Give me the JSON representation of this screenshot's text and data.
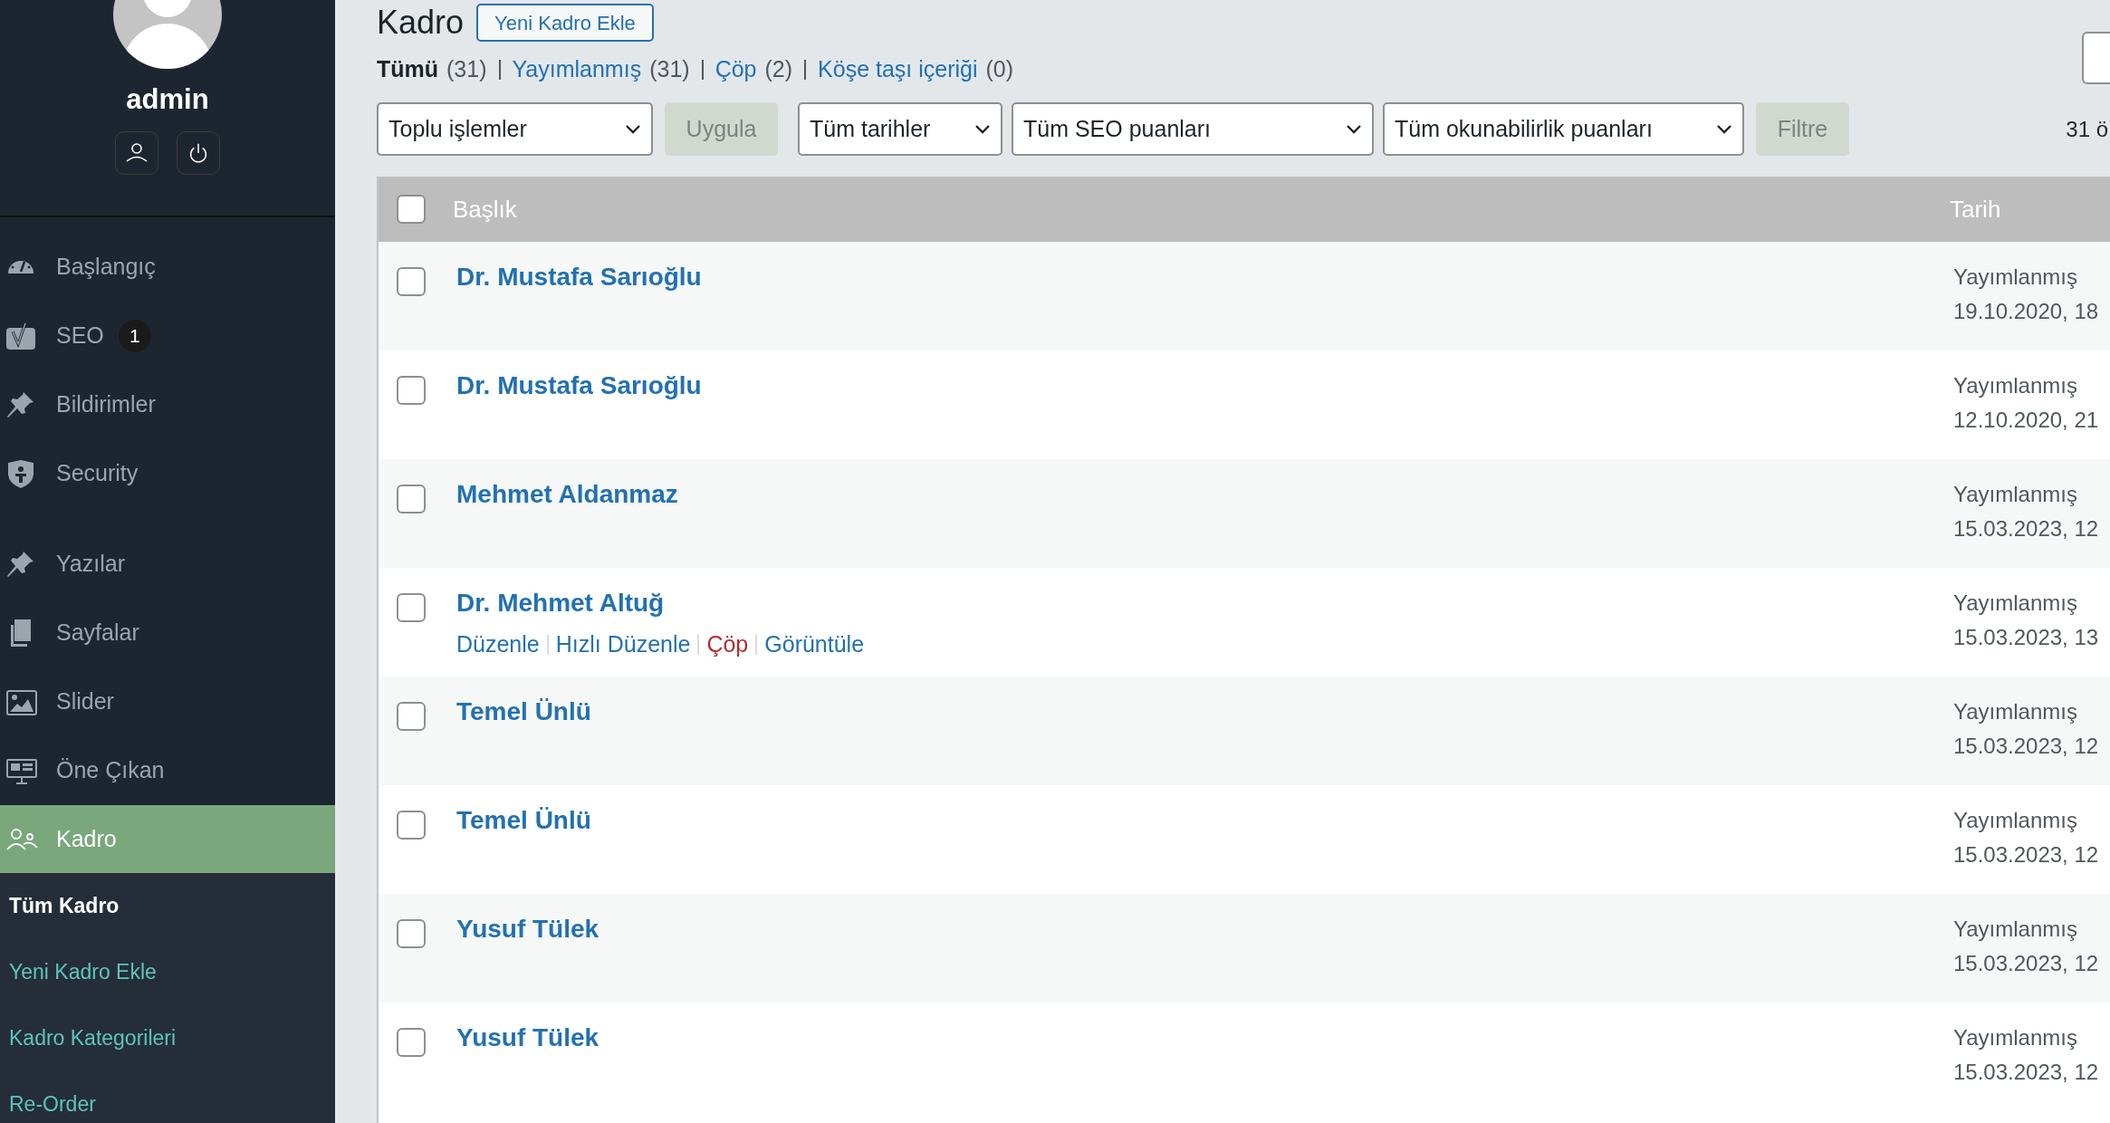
{
  "sidebar": {
    "user": {
      "name": "admin"
    },
    "menu_groups": [
      [
        {
          "label": "Başlangıç",
          "selected": false
        },
        {
          "label": "SEO",
          "badge": "1",
          "selected": false
        },
        {
          "label": "Bildirimler",
          "selected": false
        },
        {
          "label": "Security",
          "selected": false
        }
      ],
      [
        {
          "label": "Yazılar",
          "selected": false
        },
        {
          "label": "Sayfalar",
          "selected": false
        },
        {
          "label": "Slider",
          "selected": false
        },
        {
          "label": "Öne Çıkan",
          "selected": false
        },
        {
          "label": "Kadro",
          "selected": true
        }
      ]
    ],
    "submenu": [
      {
        "label": "Tüm Kadro",
        "selected": true
      },
      {
        "label": "Yeni Kadro Ekle",
        "selected": false
      },
      {
        "label": "Kadro Kategorileri",
        "selected": false
      },
      {
        "label": "Re-Order",
        "selected": false
      }
    ]
  },
  "page": {
    "title": "Kadro",
    "add_button": "Yeni Kadro Ekle"
  },
  "views": [
    {
      "label": "Tümü",
      "count": "(31)",
      "selected": true
    },
    {
      "label": "Yayımlanmış",
      "count": "(31)",
      "selected": false
    },
    {
      "label": "Çöp",
      "count": "(2)",
      "selected": false
    },
    {
      "label": "Köşe taşı içeriği",
      "count": "(0)",
      "selected": false
    }
  ],
  "filters": [
    {
      "kind": "select",
      "value": "Toplu işlemler"
    },
    {
      "kind": "button",
      "label": "Uygula",
      "disabled": true
    },
    {
      "kind": "select",
      "value": "Tüm tarihler"
    },
    {
      "kind": "select",
      "value": "Tüm SEO puanları"
    },
    {
      "kind": "select",
      "value": "Tüm okunabilirlik puanları"
    },
    {
      "kind": "button",
      "label": "Filtre",
      "disabled": true
    }
  ],
  "item_count": "31 ö",
  "table": {
    "select_all": {
      "checked": false
    },
    "columns": [
      "Başlık",
      "Tarih"
    ],
    "rows": [
      {
        "title": "Dr. Mustafa Sarıoğlu",
        "status": "Yayımlanmış",
        "date": "19.10.2020, 18",
        "checked": false
      },
      {
        "title": "Dr. Mustafa Sarıoğlu",
        "status": "Yayımlanmış",
        "date": "12.10.2020, 21",
        "checked": false
      },
      {
        "title": "Mehmet Aldanmaz",
        "status": "Yayımlanmış",
        "date": "15.03.2023, 12",
        "checked": false
      },
      {
        "title": "Dr. Mehmet Altuğ",
        "status": "Yayımlanmış",
        "date": "15.03.2023, 13",
        "checked": false,
        "actions": [
          {
            "label": "Düzenle",
            "kind": "link"
          },
          {
            "label": "Hızlı Düzenle",
            "kind": "link"
          },
          {
            "label": "Çöp",
            "kind": "danger"
          },
          {
            "label": "Görüntüle",
            "kind": "link"
          }
        ]
      },
      {
        "title": "Temel Ünlü",
        "status": "Yayımlanmış",
        "date": "15.03.2023, 12",
        "checked": false
      },
      {
        "title": "Temel Ünlü",
        "status": "Yayımlanmış",
        "date": "15.03.2023, 12",
        "checked": false
      },
      {
        "title": "Yusuf Tülek",
        "status": "Yayımlanmış",
        "date": "15.03.2023, 12",
        "checked": false
      },
      {
        "title": "Yusuf Tülek",
        "status": "Yayımlanmış",
        "date": "15.03.2023, 12",
        "checked": false
      }
    ]
  }
}
